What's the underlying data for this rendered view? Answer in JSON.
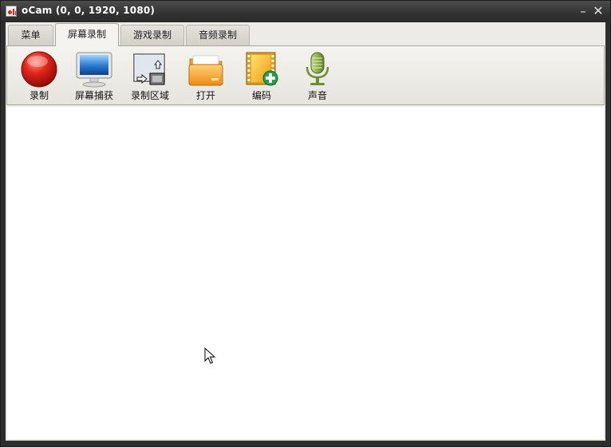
{
  "window": {
    "title": "oCam (0, 0, 1920, 1080)",
    "minimize_glyph": "–",
    "close_glyph": "✕"
  },
  "tabs": [
    {
      "label": "菜单",
      "active": false
    },
    {
      "label": "屏幕录制",
      "active": true
    },
    {
      "label": "游戏录制",
      "active": false
    },
    {
      "label": "音频录制",
      "active": false
    }
  ],
  "toolbar": {
    "items": [
      {
        "label": "录制",
        "icon": "record-icon"
      },
      {
        "label": "屏幕捕获",
        "icon": "monitor-icon"
      },
      {
        "label": "录制区域",
        "icon": "resize-area-icon"
      },
      {
        "label": "打开",
        "icon": "folder-icon"
      },
      {
        "label": "编码",
        "icon": "film-add-icon"
      },
      {
        "label": "声音",
        "icon": "microphone-icon"
      }
    ]
  },
  "colors": {
    "titlebar": "#323232",
    "record_red": "#d52a1f",
    "client_bg": "#ecebe7"
  }
}
